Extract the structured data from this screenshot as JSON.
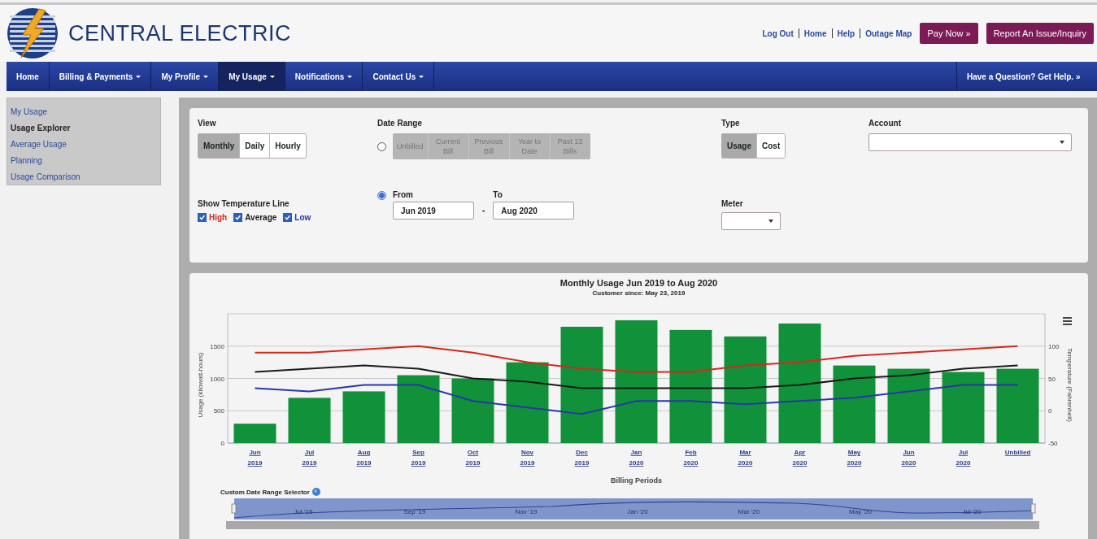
{
  "header": {
    "logo_text": "CENTRAL ELECTRIC",
    "links": [
      "Log Out",
      "Home",
      "Help",
      "Outage Map"
    ],
    "buttons": [
      "Pay Now »",
      "Report An Issue/Inquiry"
    ]
  },
  "nav": {
    "items": [
      {
        "label": "Home",
        "dropdown": false,
        "selected": false
      },
      {
        "label": "Billing & Payments",
        "dropdown": true,
        "selected": false
      },
      {
        "label": "My Profile",
        "dropdown": true,
        "selected": false
      },
      {
        "label": "My Usage",
        "dropdown": true,
        "selected": true
      },
      {
        "label": "Notifications",
        "dropdown": true,
        "selected": false
      },
      {
        "label": "Contact Us",
        "dropdown": true,
        "selected": false
      }
    ],
    "help_link": "Have a Question? Get Help. »"
  },
  "sidebar": {
    "items": [
      {
        "label": "My Usage",
        "selected": false
      },
      {
        "label": "Usage Explorer",
        "selected": true
      },
      {
        "label": "Average Usage",
        "selected": false
      },
      {
        "label": "Planning",
        "selected": false
      },
      {
        "label": "Usage Comparison",
        "selected": false
      }
    ]
  },
  "filters": {
    "view": {
      "label": "View",
      "options": [
        {
          "label": "Monthly",
          "selected": true
        },
        {
          "label": "Daily",
          "selected": false
        },
        {
          "label": "Hourly",
          "selected": false
        }
      ]
    },
    "date_range": {
      "label": "Date Range",
      "preset_selected": false,
      "presets_disabled": true,
      "presets": [
        "Unbilled",
        "Current Bill",
        "Previous Bill",
        "Year to Date",
        "Past 13 Bills"
      ],
      "custom_selected": true,
      "from_label": "From",
      "from": "Jun 2019",
      "separator": "-",
      "to_label": "To",
      "to": "Aug 2020"
    },
    "type": {
      "label": "Type",
      "options": [
        {
          "label": "Usage",
          "selected": true
        },
        {
          "label": "Cost",
          "selected": false
        }
      ]
    },
    "account": {
      "label": "Account"
    },
    "temperature": {
      "label": "Show Temperature Line",
      "options": [
        {
          "label": "High",
          "checked": true,
          "color": "#d9261c"
        },
        {
          "label": "Average",
          "checked": true,
          "color": "#1a1a1a"
        },
        {
          "label": "Low",
          "checked": true,
          "color": "#2b35a8"
        }
      ]
    },
    "meter": {
      "label": "Meter"
    }
  },
  "chart": {
    "title": "Monthly Usage Jun 2019 to Aug 2020",
    "subtitle": "Customer since: May 23, 2019",
    "chart_data": {
      "type": "bar",
      "xlabel": "Billing Periods",
      "ylabel": "Usage (kilowatt-hours)",
      "categories": [
        "Jun 2019",
        "Jul 2019",
        "Aug 2019",
        "Sep 2019",
        "Oct 2019",
        "Nov 2019",
        "Dec 2019",
        "Jan 2020",
        "Feb 2020",
        "Mar 2020",
        "Apr 2020",
        "May 2020",
        "Jun 2020",
        "Jul 2020",
        "Unbilled"
      ],
      "ylim": [
        0,
        2000
      ],
      "yticks": [
        0,
        500,
        1000,
        1500
      ],
      "grid": true,
      "series": [
        {
          "color": "#11913a",
          "values": [
            300,
            700,
            800,
            1050,
            1000,
            1250,
            1800,
            1900,
            1750,
            1650,
            1850,
            1200,
            1150,
            1100,
            1150
          ]
        }
      ]
    },
    "temperature_overlay": {
      "chart_data": {
        "type": "line",
        "ylabel": "Temperature (Fahrenheit)",
        "ylim": [
          -50,
          150
        ],
        "yticks": [
          -50,
          0,
          50,
          100
        ],
        "series": [
          {
            "color": "#d9261c",
            "values": [
              90,
              90,
              95,
              100,
              90,
              75,
              65,
              60,
              60,
              70,
              75,
              85,
              90,
              95,
              100
            ]
          },
          {
            "color": "#1a1a1a",
            "values": [
              60,
              65,
              70,
              65,
              50,
              45,
              35,
              35,
              35,
              35,
              40,
              50,
              55,
              65,
              70
            ]
          },
          {
            "color": "#2b35a8",
            "values": [
              35,
              30,
              40,
              40,
              15,
              5,
              -5,
              15,
              15,
              10,
              15,
              20,
              30,
              40,
              40
            ]
          }
        ]
      }
    },
    "range_selector": {
      "label": "Custom Date Range Selector",
      "ticks": [
        "Jul '19",
        "Sep '19",
        "Nov '19",
        "Jan '20",
        "Mar '20",
        "May '20",
        "Jul '20"
      ]
    }
  }
}
